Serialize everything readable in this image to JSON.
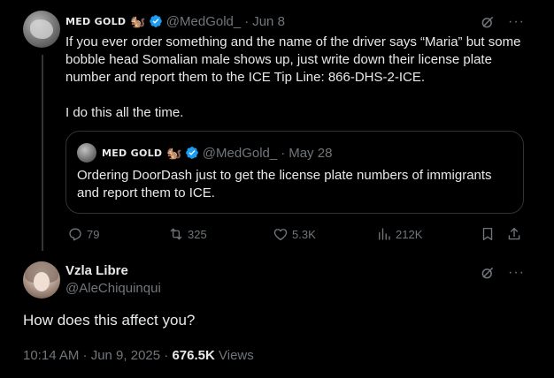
{
  "colors": {
    "background": "#000000",
    "text_primary": "#e7e9ea",
    "text_secondary": "#71767b",
    "verified_blue": "#1d9bf0",
    "border": "#2f3336"
  },
  "tweet": {
    "author_name": "MED GOLD",
    "author_emoji": "🐿️",
    "handle": "@MedGold_",
    "separator": "·",
    "date": "Jun 8",
    "text_line1": "If you ever order something and the name of the driver says “Maria” but some bobble head Somalian male shows up, just write down their license plate number and report them to the ICE Tip Line: 866-DHS-2-ICE.",
    "text_line2": "I do this all the time.",
    "quote": {
      "author_name": "MED GOLD",
      "author_emoji": "🐿️",
      "handle": "@MedGold_",
      "separator": "·",
      "date": "May 28",
      "text": "Ordering DoorDash just to get the license plate numbers of immigrants and report them to ICE."
    },
    "actions": {
      "replies": "79",
      "reposts": "325",
      "likes": "5.3K",
      "views": "212K"
    },
    "icons": [
      "grok-icon",
      "more-icon",
      "verified-icon",
      "reply-icon",
      "repost-icon",
      "like-icon",
      "views-icon",
      "bookmark-icon",
      "share-icon"
    ]
  },
  "reply": {
    "author_name": "Vzla Libre",
    "handle": "@AleChiquinqui",
    "text": "How does this affect you?",
    "timestamp": "10:14 AM · Jun 9, 2025",
    "separator": "·",
    "views_count": "676.5K",
    "views_label": "Views"
  }
}
